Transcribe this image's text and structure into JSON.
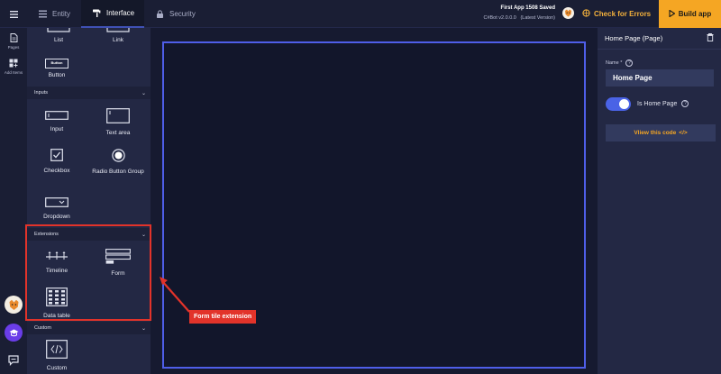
{
  "topbar": {
    "tabs": [
      {
        "label": "Entity",
        "icon": "database-icon"
      },
      {
        "label": "Interface",
        "icon": "paint-roller-icon"
      },
      {
        "label": "Security",
        "icon": "lock-icon"
      }
    ],
    "save_status": "First App 1508 Saved",
    "version_name": "C#Bot v2.0.0.0",
    "version_note": "(Latest Version)",
    "check_errors_label": "Check for Errors",
    "build_label": "Build app"
  },
  "rail": {
    "items": [
      {
        "label": "Pages",
        "icon": "page-icon"
      },
      {
        "label": "Add Items",
        "icon": "add-items-icon"
      }
    ]
  },
  "components": {
    "top_tiles": [
      {
        "label": "List"
      },
      {
        "label": "Link"
      },
      {
        "label": "Button",
        "glyph_text": "Button"
      }
    ],
    "sections": [
      {
        "label": "Inputs",
        "tiles": [
          {
            "label": "Input"
          },
          {
            "label": "Text area"
          },
          {
            "label": "Checkbox"
          },
          {
            "label": "Radio Button Group"
          },
          {
            "label": "Dropdown"
          }
        ]
      },
      {
        "label": "Extensions",
        "tiles": [
          {
            "label": "Timeline"
          },
          {
            "label": "Form"
          },
          {
            "label": "Data table"
          }
        ]
      },
      {
        "label": "Custom",
        "tiles": [
          {
            "label": "Custom"
          }
        ]
      }
    ]
  },
  "annotation": {
    "label": "Form tile extension",
    "color": "#e2332a"
  },
  "properties": {
    "title": "Home Page (Page)",
    "name_label": "Name",
    "name_required_mark": "*",
    "name_value": "Home Page",
    "is_home_page_label": "Is Home Page",
    "is_home_page_checked": true,
    "view_code_label": "Vliew this code",
    "view_code_icon": "</>"
  },
  "colors": {
    "accent": "#4f5ee8",
    "build": "#f5a623",
    "warning": "#f4b13c"
  }
}
